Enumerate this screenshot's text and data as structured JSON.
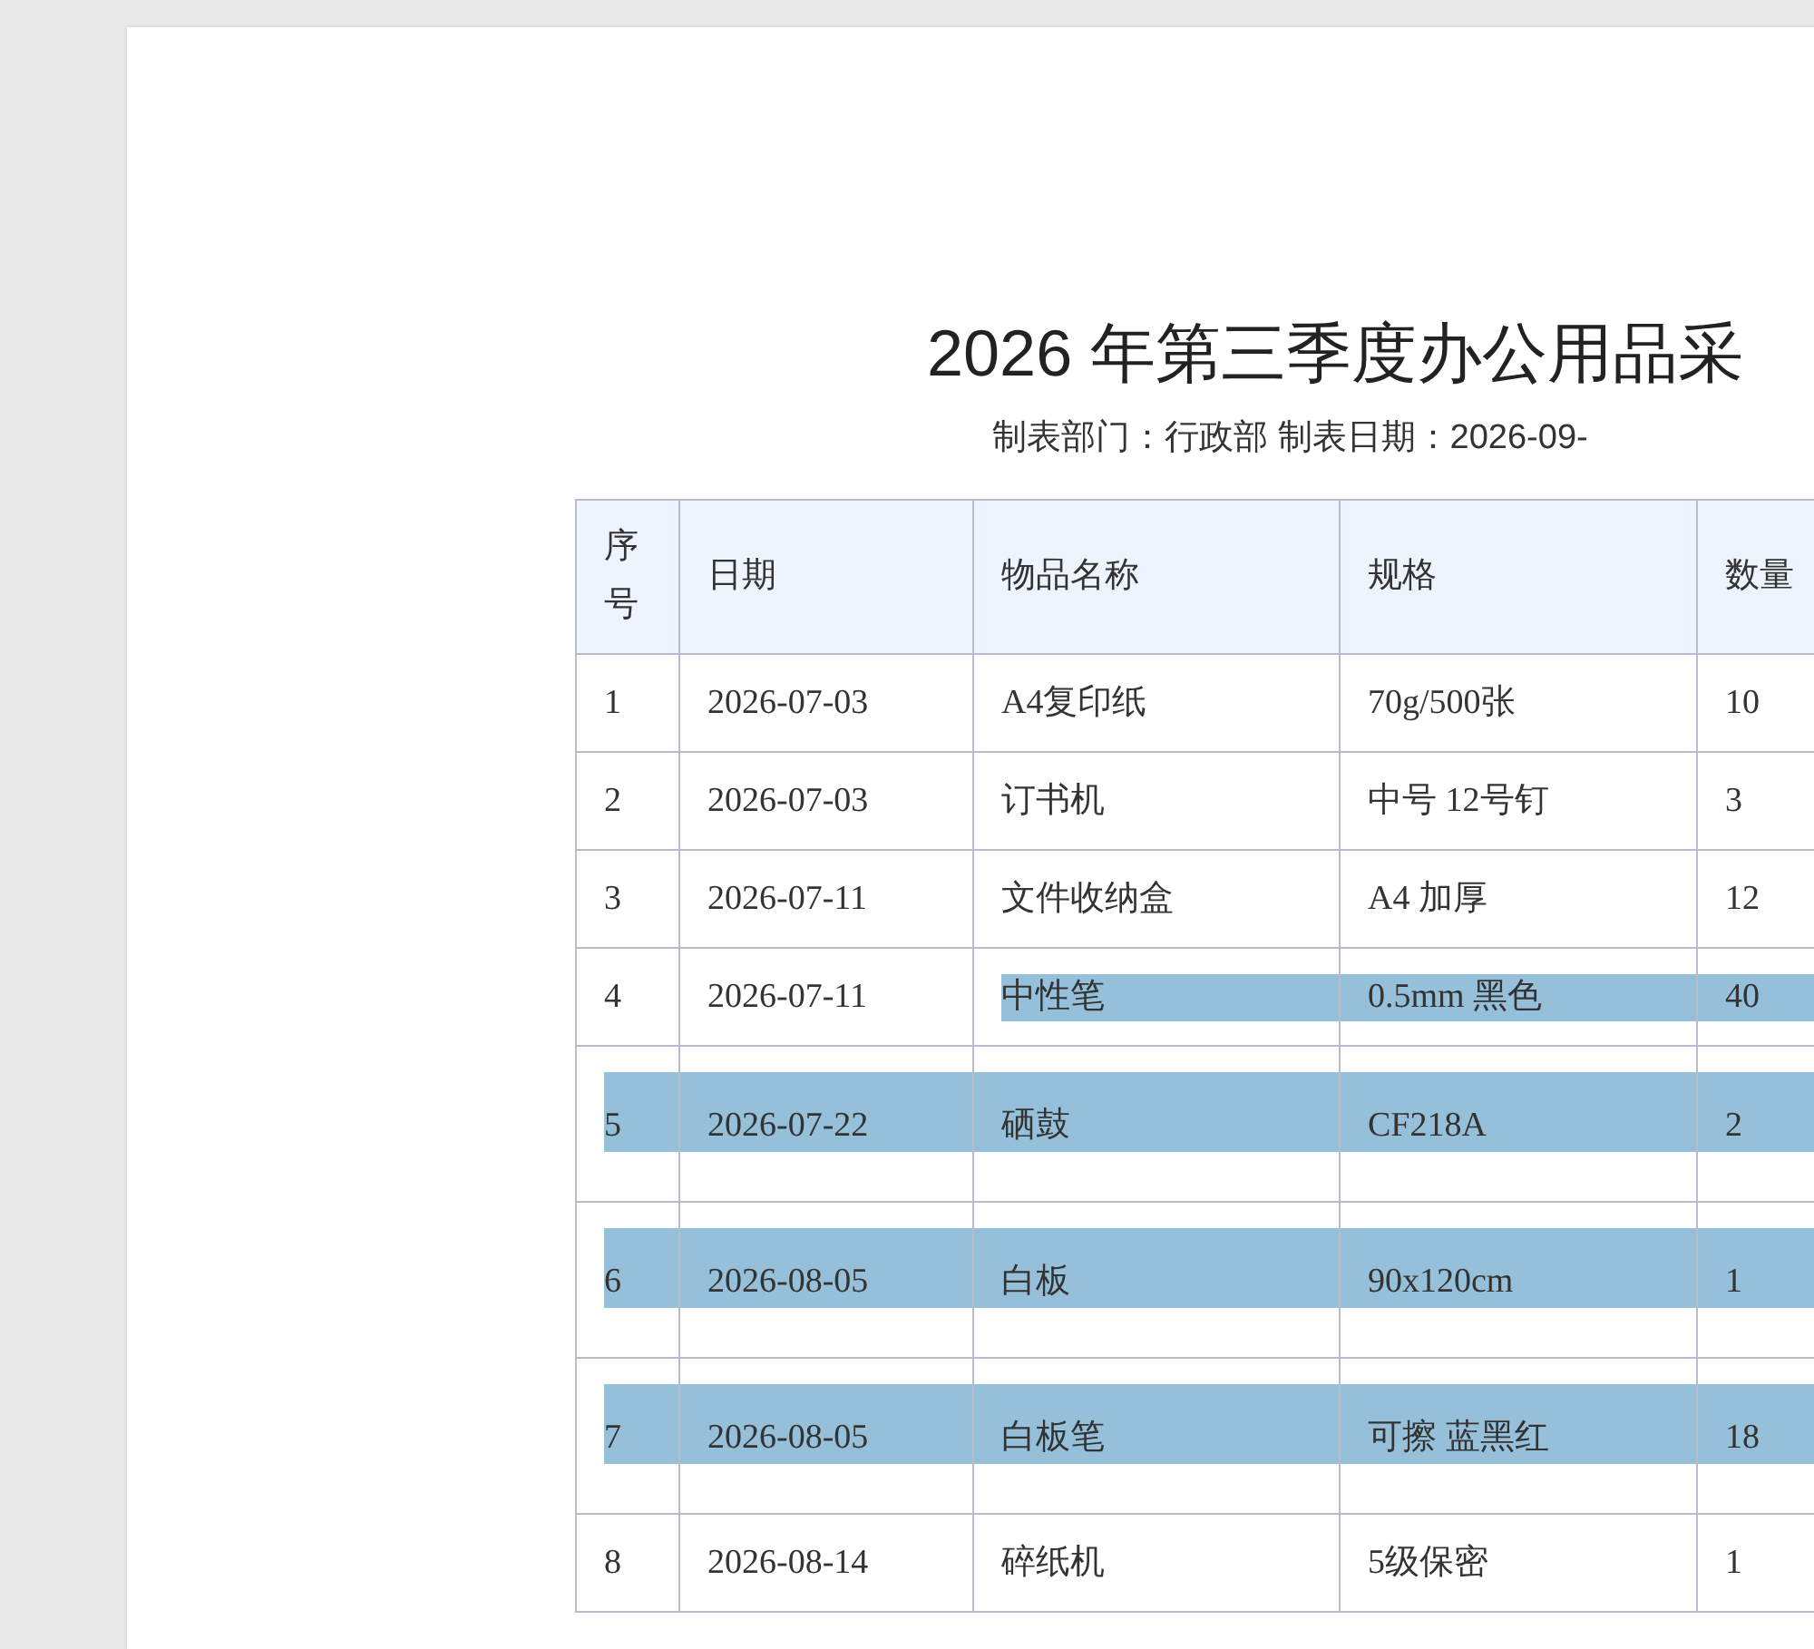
{
  "document": {
    "title": "2026 年第三季度办公用品采",
    "subtitle": "制表部门：行政部 制表日期：2026-09-"
  },
  "table": {
    "columns": [
      "序号",
      "日期",
      "物品名称",
      "规格",
      "数量"
    ],
    "rows": [
      {
        "cells": [
          {
            "text": "1",
            "selected": false
          },
          {
            "text": "2026-07-03",
            "selected": false
          },
          {
            "text": "A4复印纸",
            "selected": false
          },
          {
            "text": "70g/500张",
            "selected": false
          },
          {
            "text": "10",
            "selected": false
          }
        ]
      },
      {
        "cells": [
          {
            "text": "2",
            "selected": false
          },
          {
            "text": "2026-07-03",
            "selected": false
          },
          {
            "text": "订书机",
            "selected": false
          },
          {
            "text": "中号 12号钉",
            "selected": false
          },
          {
            "text": "3",
            "selected": false
          }
        ]
      },
      {
        "cells": [
          {
            "text": "3",
            "selected": false
          },
          {
            "text": "2026-07-11",
            "selected": false
          },
          {
            "text": "文件收纳盒",
            "selected": false
          },
          {
            "text": "A4 加厚",
            "selected": false
          },
          {
            "text": "12",
            "selected": false
          }
        ]
      },
      {
        "cells": [
          {
            "text": "4",
            "selected": false
          },
          {
            "text": "2026-07-11",
            "selected": false
          },
          {
            "text": "中性笔",
            "selected": true
          },
          {
            "text": "0.5mm 黑色",
            "selected": true
          },
          {
            "text": "40",
            "selected": true
          }
        ]
      },
      {
        "cells": [
          {
            "text": "5",
            "selected": true
          },
          {
            "text": "2026-07-22",
            "selected": true
          },
          {
            "text": "硒鼓",
            "selected": true
          },
          {
            "text": "CF218A",
            "selected": true
          },
          {
            "text": "2",
            "selected": true
          }
        ]
      },
      {
        "cells": [
          {
            "text": "6",
            "selected": true
          },
          {
            "text": "2026-08-05",
            "selected": true
          },
          {
            "text": "白板",
            "selected": true
          },
          {
            "text": "90x120cm",
            "selected": true
          },
          {
            "text": "1",
            "selected": true
          }
        ]
      },
      {
        "cells": [
          {
            "text": "7",
            "selected": true
          },
          {
            "text": "2026-08-05",
            "selected": true
          },
          {
            "text": "白板笔",
            "selected": true
          },
          {
            "text": "可擦 蓝黑红",
            "selected": true
          },
          {
            "text": "18",
            "selected": true
          }
        ]
      },
      {
        "cells": [
          {
            "text": "8",
            "selected": false
          },
          {
            "text": "2026-08-14",
            "selected": false
          },
          {
            "text": "碎纸机",
            "selected": false
          },
          {
            "text": "5级保密",
            "selected": false
          },
          {
            "text": "1",
            "selected": false
          }
        ]
      }
    ]
  }
}
